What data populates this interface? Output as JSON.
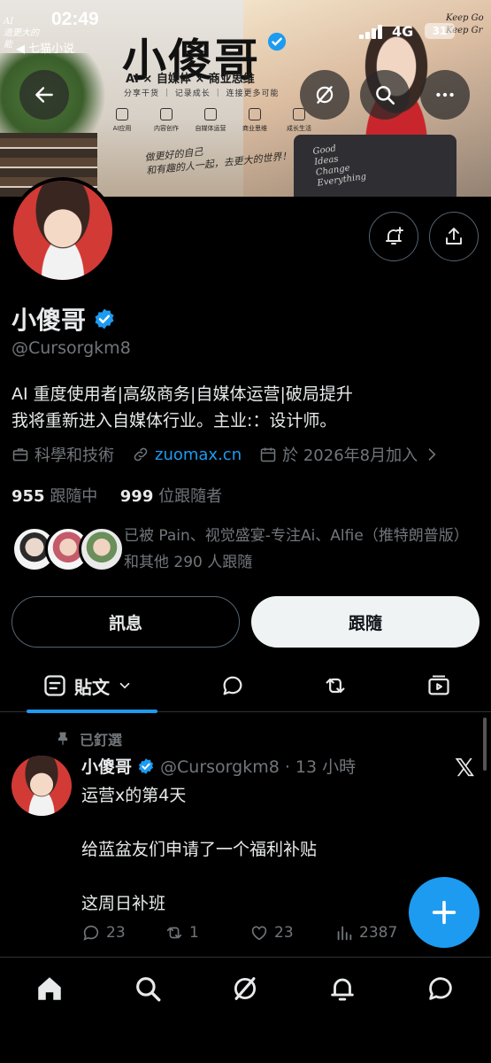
{
  "status_bar": {
    "time": "02:49",
    "back_app": "◀ 七猫小说",
    "network": "4G",
    "battery": "31"
  },
  "banner": {
    "title": "小傻哥",
    "subtitle": "AI × 自媒体 × 商业思维",
    "tagline": "分享干货 ｜ 记录成长 ｜ 连接更多可能",
    "icons": [
      "AI应用",
      "内容创作",
      "自媒体运营",
      "商业思维",
      "成长生活"
    ],
    "script": "做更好的自己\n和有趣的人一起，去更大的世界！",
    "laptop_text": "Good\nIdeas\nChange\nEverything",
    "corner_note_left": "AI\n造更大的\n能",
    "corner_note_right": "Keep Go\nKeep Gr"
  },
  "profile": {
    "name": "小傻哥",
    "handle": "@Cursorgkm8",
    "bio_line1": "AI 重度使用者|高级商务|自媒体运营|破局提升",
    "bio_line2": "我将重新进入自媒体行业。主业:：设计师。",
    "category": "科學和技術",
    "link": "zuomax.cn",
    "joined": "於 2026年8月加入",
    "following_count": "955",
    "following_label": "跟隨中",
    "followers_count": "999",
    "followers_label": "位跟隨者",
    "followed_by": "已被 Pain、视觉盛宴-专注Ai、Alfie（推特朗普版） 和其他 290 人跟隨"
  },
  "buttons": {
    "message": "訊息",
    "follow": "跟隨"
  },
  "tabs": {
    "posts_label": "貼文"
  },
  "pinned_label": "已釘選",
  "tweet": {
    "author": "小傻哥",
    "handle_time": "@Cursorgkm8 · 13 小時",
    "lines": [
      "运营x的第4天",
      "",
      "给蓝盆友们申请了一个福利补贴",
      "",
      "这周日补班"
    ],
    "replies": "23",
    "reposts": "1",
    "likes": "23",
    "views": "2387"
  },
  "colors": {
    "accent": "#1d9bf0",
    "background": "#000000",
    "muted": "#71767b",
    "text": "#e7e9ea"
  }
}
